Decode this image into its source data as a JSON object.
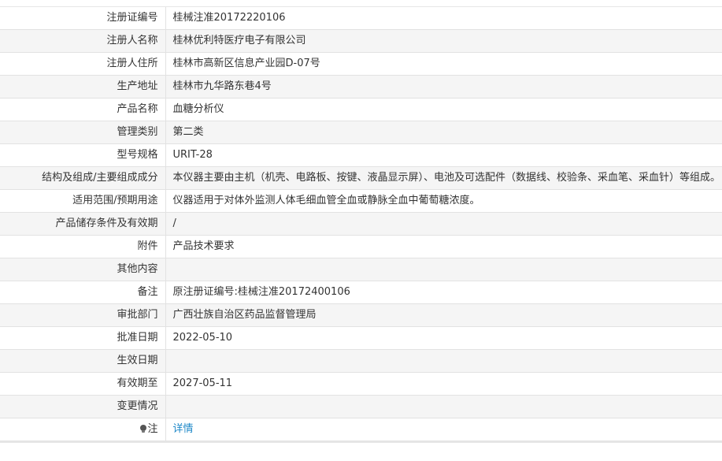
{
  "rows": [
    {
      "label": "注册证编号",
      "value": "桂械注准20172220106"
    },
    {
      "label": "注册人名称",
      "value": "桂林优利特医疗电子有限公司"
    },
    {
      "label": "注册人住所",
      "value": "桂林市高新区信息产业园D-07号"
    },
    {
      "label": "生产地址",
      "value": "桂林市九华路东巷4号"
    },
    {
      "label": "产品名称",
      "value": "血糖分析仪"
    },
    {
      "label": "管理类别",
      "value": "第二类"
    },
    {
      "label": "型号规格",
      "value": "URIT-28"
    },
    {
      "label": "结构及组成/主要组成成分",
      "value": "本仪器主要由主机（机壳、电路板、按键、液晶显示屏）、电池及可选配件（数据线、校验条、采血笔、采血针）等组成。"
    },
    {
      "label": "适用范围/预期用途",
      "value": "仪器适用于对体外监测人体毛细血管全血或静脉全血中葡萄糖浓度。"
    },
    {
      "label": "产品储存条件及有效期",
      "value": "/"
    },
    {
      "label": "附件",
      "value": "产品技术要求"
    },
    {
      "label": "其他内容",
      "value": ""
    },
    {
      "label": "备注",
      "value": "原注册证编号:桂械注准20172400106"
    },
    {
      "label": "审批部门",
      "value": "广西壮族自治区药品监督管理局"
    },
    {
      "label": "批准日期",
      "value": "2022-05-10"
    },
    {
      "label": "生效日期",
      "value": ""
    },
    {
      "label": "有效期至",
      "value": "2027-05-11"
    },
    {
      "label": "变更情况",
      "value": ""
    }
  ],
  "note_row": {
    "label": "注",
    "link": "详情",
    "icon": "lightbulb-icon"
  },
  "colors": {
    "link": "#1e88c8",
    "border": "#e2e2e2",
    "stripe": "#f5f5f5"
  }
}
